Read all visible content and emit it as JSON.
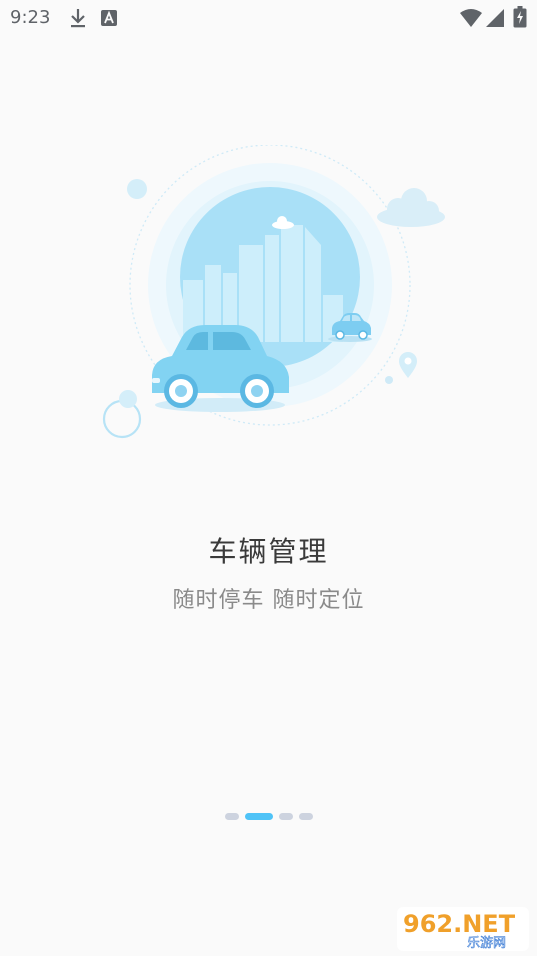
{
  "status_bar": {
    "time": "9:23",
    "icons": [
      "download-icon",
      "a-notification-icon",
      "wifi-icon",
      "signal-icon",
      "battery-charging-icon"
    ]
  },
  "onboarding": {
    "title": "车辆管理",
    "subtitle": "随时停车 随时定位",
    "page_count": 4,
    "active_page": 2
  },
  "watermark": {
    "brand": "962.NET",
    "tagline": "乐游网"
  },
  "colors": {
    "accent": "#4fc3f7",
    "car": "#7dd3f2",
    "background": "#fafafa",
    "dot_inactive": "#cdd3df"
  }
}
